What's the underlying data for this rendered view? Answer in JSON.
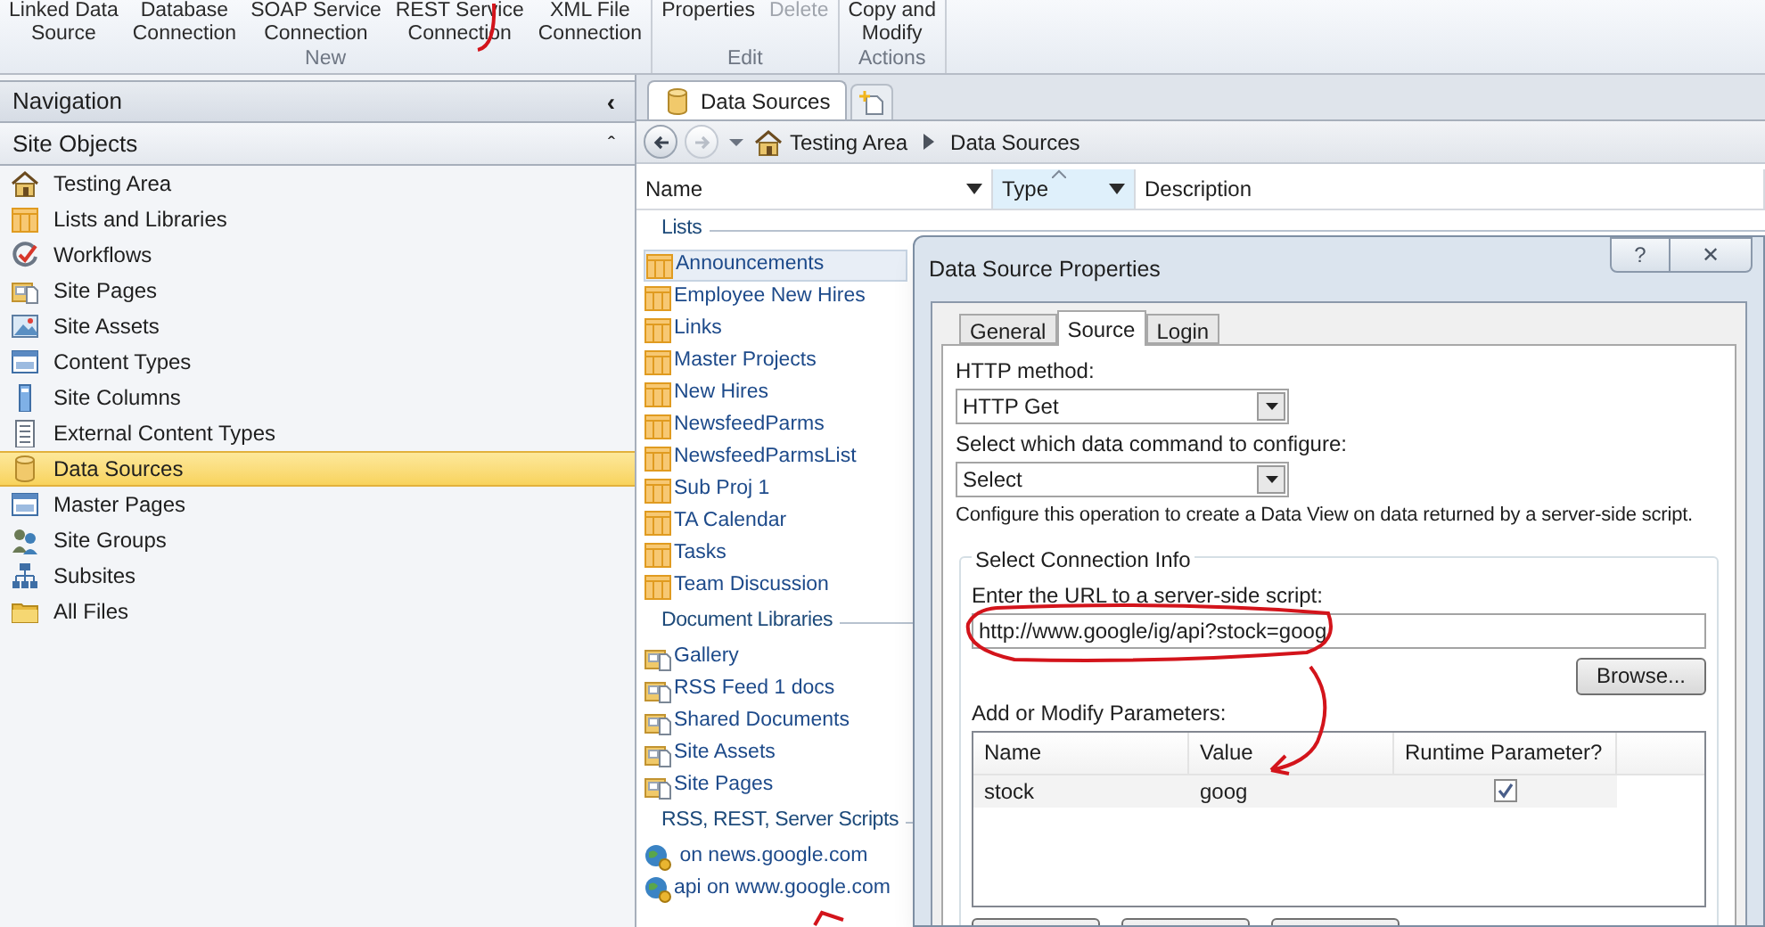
{
  "ribbon": {
    "groups": [
      {
        "label": "New",
        "buttons": [
          {
            "lines": [
              "Linked Data",
              "Source"
            ],
            "disabled": false
          },
          {
            "lines": [
              "Database",
              "Connection"
            ],
            "disabled": false
          },
          {
            "lines": [
              "SOAP Service",
              "Connection"
            ],
            "disabled": false
          },
          {
            "lines": [
              "REST Service",
              "Connection"
            ],
            "disabled": false
          },
          {
            "lines": [
              "XML File",
              "Connection"
            ],
            "disabled": false
          }
        ]
      },
      {
        "label": "Edit",
        "buttons": [
          {
            "lines": [
              "Properties"
            ],
            "disabled": false
          },
          {
            "lines": [
              "Delete"
            ],
            "disabled": true
          }
        ]
      },
      {
        "label": "Actions",
        "buttons": [
          {
            "lines": [
              "Copy and",
              "Modify"
            ],
            "disabled": false
          }
        ]
      }
    ]
  },
  "navigation": {
    "title": "Navigation",
    "collapse_glyph": "‹",
    "section": "Site Objects",
    "section_glyph": "ˆ",
    "items": [
      {
        "label": "Testing Area",
        "kind": "home",
        "selected": false
      },
      {
        "label": "Lists and Libraries",
        "kind": "list",
        "selected": false
      },
      {
        "label": "Workflows",
        "kind": "workflow",
        "selected": false
      },
      {
        "label": "Site Pages",
        "kind": "doclib",
        "selected": false
      },
      {
        "label": "Site Assets",
        "kind": "image",
        "selected": false
      },
      {
        "label": "Content Types",
        "kind": "window",
        "selected": false
      },
      {
        "label": "Site Columns",
        "kind": "column",
        "selected": false
      },
      {
        "label": "External Content Types",
        "kind": "page",
        "selected": false
      },
      {
        "label": "Data Sources",
        "kind": "database",
        "selected": true
      },
      {
        "label": "Master Pages",
        "kind": "window",
        "selected": false
      },
      {
        "label": "Site Groups",
        "kind": "people",
        "selected": false
      },
      {
        "label": "Subsites",
        "kind": "tree",
        "selected": false
      },
      {
        "label": "All Files",
        "kind": "folder",
        "selected": false
      }
    ]
  },
  "tabs": [
    {
      "label": "Data Sources",
      "selected": true
    }
  ],
  "breadcrumb": [
    "Testing Area",
    "Data Sources"
  ],
  "columns": [
    {
      "label": "Name",
      "sorted": false
    },
    {
      "label": "Type",
      "sorted": true
    },
    {
      "label": "Description",
      "sorted": false
    }
  ],
  "groups": [
    {
      "title": "Lists",
      "items": [
        {
          "label": "Announcements",
          "kind": "list",
          "selected": true
        },
        {
          "label": "Employee New Hires",
          "kind": "list",
          "selected": false
        },
        {
          "label": "Links",
          "kind": "list",
          "selected": false
        },
        {
          "label": "Master Projects",
          "kind": "list",
          "selected": false
        },
        {
          "label": "New Hires",
          "kind": "list",
          "selected": false
        },
        {
          "label": "NewsfeedParms",
          "kind": "list",
          "selected": false
        },
        {
          "label": "NewsfeedParmsList",
          "kind": "list",
          "selected": false
        },
        {
          "label": "Sub Proj 1",
          "kind": "list",
          "selected": false
        },
        {
          "label": "TA Calendar",
          "kind": "list",
          "selected": false
        },
        {
          "label": "Tasks",
          "kind": "list",
          "selected": false
        },
        {
          "label": "Team Discussion",
          "kind": "list",
          "selected": false
        }
      ]
    },
    {
      "title": "Document Libraries",
      "items": [
        {
          "label": "Gallery",
          "kind": "doclib",
          "selected": false
        },
        {
          "label": "RSS Feed 1 docs",
          "kind": "doclib",
          "selected": false
        },
        {
          "label": "Shared Documents",
          "kind": "doclib",
          "selected": false
        },
        {
          "label": "Site Assets",
          "kind": "doclib",
          "selected": false
        },
        {
          "label": "Site Pages",
          "kind": "doclib",
          "selected": false
        }
      ]
    },
    {
      "title": "RSS, REST, Server Scripts",
      "items": [
        {
          "label": " on news.google.com",
          "kind": "globe",
          "selected": false
        },
        {
          "label": "api on www.google.com",
          "kind": "globe",
          "selected": false
        }
      ]
    }
  ],
  "dialog": {
    "title": "Data Source Properties",
    "help_glyph": "?",
    "close_glyph": "✕",
    "tabs": [
      {
        "label": "General",
        "selected": false
      },
      {
        "label": "Source",
        "selected": true
      },
      {
        "label": "Login",
        "selected": false
      }
    ],
    "http_method_label": "HTTP method:",
    "http_method": "HTTP Get",
    "command_label": "Select which data command to configure:",
    "command": "Select",
    "description": "Configure this operation to create a Data View on data returned by a server-side script.",
    "connection_group": "Select Connection Info",
    "url_label": "Enter the URL to a server-side script:",
    "url": "http://www.google/ig/api?stock=goog",
    "browse_button": "Browse...",
    "params_label": "Add or Modify Parameters:",
    "params_columns": [
      "Name",
      "Value",
      "Runtime Parameter?"
    ],
    "params": [
      {
        "name": "stock",
        "value": "goog",
        "runtime": true
      }
    ]
  }
}
